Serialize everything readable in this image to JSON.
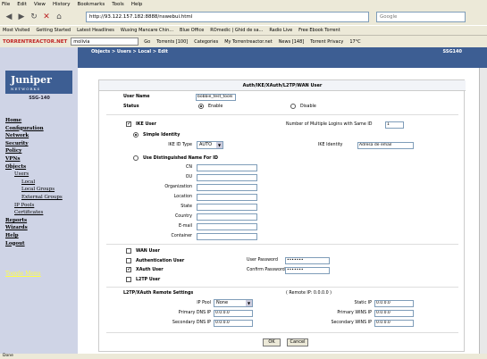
{
  "browser": {
    "menu": [
      "File",
      "Edit",
      "View",
      "History",
      "Bookmarks",
      "Tools",
      "Help"
    ],
    "url": "http://93.122.157.182:8888/nswebui.html",
    "search_placeholder": "Google",
    "bookmarks": [
      "Most Visited",
      "Getting Started",
      "Latest Headlines",
      "Wuxing Mancare Chin...",
      "Blue Office",
      "ROmedic | Ghid de sa...",
      "Radio Live",
      "Free Ebook Torrent"
    ],
    "toolbar": {
      "brand": "TORRENTREACTOR.NET",
      "search_value": "molivia",
      "go": "Go",
      "items": [
        "Torrents [100]",
        "Categories",
        "My Torrentreactor.net",
        "News [148]",
        "Torrent Privacy",
        "17°C"
      ]
    },
    "status": "Done"
  },
  "app": {
    "logo": "Juniper",
    "logo_sub": "NETWORKS",
    "device_name": "SSG-140",
    "breadcrumb": "Objects > Users > Local > Edit",
    "device": "SSG140",
    "nav": [
      "Home",
      "Configuration",
      "Network",
      "Security",
      "Policy",
      "VPNs",
      "Objects",
      "Users",
      "Local",
      "Local Groups",
      "External Groups",
      "IP Pools",
      "Certificates",
      "Reports",
      "Wizards",
      "Help",
      "Logout"
    ],
    "toggle_menu": "Toggle Menu"
  },
  "form": {
    "title": "Auth/IKE/XAuth/L2TP/WAN User",
    "user_name_label": "User Name",
    "user_name_value": "bobbie_test_tools",
    "status_label": "Status",
    "enable_label": "Enable",
    "disable_label": "Disable",
    "ike_user_label": "IKE User",
    "multi_logins_label": "Number of Multiple Logins with Same ID",
    "multi_logins_value": "1",
    "simple_identity_label": "Simple Identity",
    "ike_id_type_label": "IKE ID Type",
    "ike_id_type_value": "AUTO",
    "ike_identity_label": "IKE Identity",
    "ike_identity_value": "Adresa de email",
    "dn_label": "Use Distinguished Name For ID",
    "dn_fields": [
      "CN",
      "OU",
      "Organization",
      "Location",
      "State",
      "Country",
      "E-mail",
      "Container"
    ],
    "wan_user_label": "WAN User",
    "auth_user_label": "Authentication User",
    "xauth_user_label": "XAuth User",
    "l2tp_user_label": "L2TP User",
    "user_password_label": "User Password",
    "user_password_value": "•••••••",
    "confirm_password_label": "Confirm Password",
    "confirm_password_value": "•••••••",
    "l2tp_settings_label": "L2TP/XAuth Remote Settings",
    "remote_ip_label": "( Remote IP: 0.0.0.0 )",
    "ip_pool_label": "IP Pool",
    "ip_pool_value": "None",
    "static_ip_label": "Static IP",
    "static_ip_value": "0.0.0.0",
    "primary_dns_label": "Primary DNS IP",
    "primary_dns_value": "0.0.0.0",
    "primary_wins_label": "Primary WINS IP",
    "primary_wins_value": "0.0.0.0",
    "secondary_dns_label": "Secondary DNS IP",
    "secondary_dns_value": "0.0.0.0",
    "secondary_wins_label": "Secondary WINS IP",
    "secondary_wins_value": "0.0.0.0",
    "ok_label": "OK",
    "cancel_label": "Cancel"
  }
}
